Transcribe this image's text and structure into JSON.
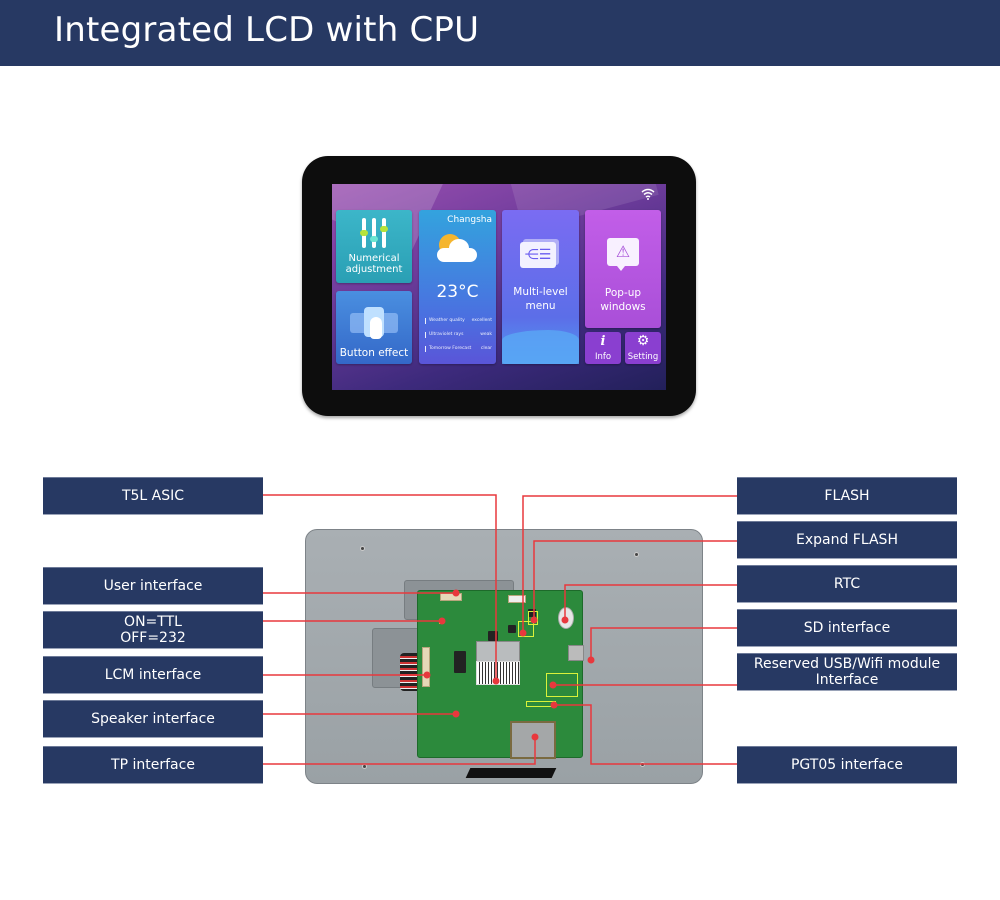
{
  "header": {
    "title": "Integrated LCD with CPU"
  },
  "lcd_screen": {
    "status_icon": "wifi-icon",
    "tiles": {
      "numerical": {
        "label": "Numerical\nadjustment",
        "icon": "sliders-icon"
      },
      "button": {
        "label": "Button effect",
        "icon": "hand-pointer-icon"
      },
      "weather": {
        "city": "Changsha",
        "temperature": "23°C",
        "icon": "partly-cloudy-icon",
        "rows": [
          {
            "name": "Weather quality",
            "value": "excellent"
          },
          {
            "name": "Ultraviolet rays",
            "value": "weak"
          },
          {
            "name": "Tomorrow Forecast",
            "value": "clear"
          }
        ]
      },
      "menu": {
        "label": "Multi-level\nmenu",
        "icon": "menu-list-icon",
        "glyph": "⋲☰"
      },
      "popup": {
        "label": "Pop-up\nwindows",
        "icon": "warning-icon",
        "glyph": "⚠"
      },
      "info": {
        "label": "Info",
        "glyph": "i"
      },
      "setting": {
        "label": "Setting",
        "glyph": "⚙"
      }
    }
  },
  "callouts": {
    "left": [
      {
        "id": "t5l-asic",
        "label": "T5L ASIC"
      },
      {
        "id": "user-interface",
        "label": "User interface"
      },
      {
        "id": "on-off-switch",
        "label": "ON=TTL\nOFF=232"
      },
      {
        "id": "lcm-interface",
        "label": "LCM interface"
      },
      {
        "id": "speaker-interface",
        "label": "Speaker  interface"
      },
      {
        "id": "tp-interface",
        "label": "TP interface"
      }
    ],
    "right": [
      {
        "id": "flash",
        "label": "FLASH"
      },
      {
        "id": "expand-flash",
        "label": "Expand FLASH"
      },
      {
        "id": "rtc",
        "label": "RTC"
      },
      {
        "id": "sd-interface",
        "label": "SD  interface"
      },
      {
        "id": "usb-wifi",
        "label": "Reserved USB/Wifi module\nInterface"
      },
      {
        "id": "pgt05",
        "label": "PGT05 interface"
      }
    ]
  },
  "colors": {
    "header_bg": "#273963",
    "label_bg": "#273963",
    "leader_line": "#e8383d",
    "highlight": "#d9f23a"
  }
}
